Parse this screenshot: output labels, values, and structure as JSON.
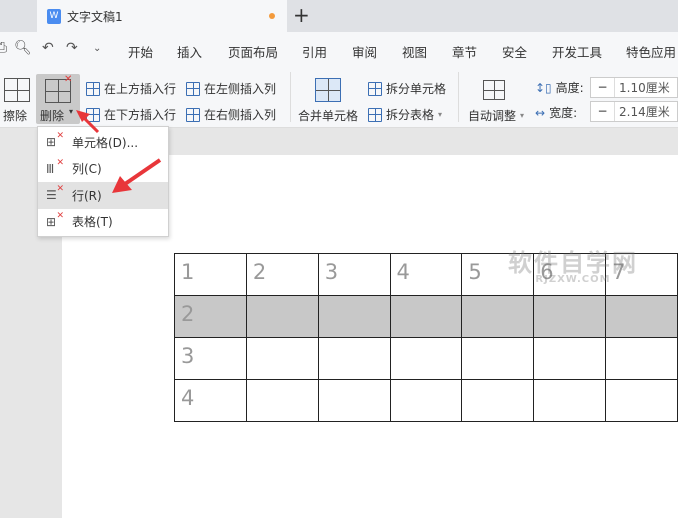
{
  "tab": {
    "title": "文字文稿1",
    "new_tab": "+"
  },
  "menu": [
    "开始",
    "插入",
    "页面布局",
    "引用",
    "审阅",
    "视图",
    "章节",
    "安全",
    "开发工具",
    "特色应用"
  ],
  "ribbon": {
    "erase": "擦除",
    "delete": "删除",
    "insert_above": "在上方插入行",
    "insert_below": "在下方插入行",
    "insert_left": "在左侧插入列",
    "insert_right": "在右侧插入列",
    "merge": "合并单元格",
    "split_cell": "拆分单元格",
    "split_table": "拆分表格",
    "auto_fit": "自动调整",
    "height_label": "高度:",
    "height_value": "1.10厘米",
    "width_label": "宽度:",
    "width_value": "2.14厘米",
    "minus": "−"
  },
  "dropdown": [
    {
      "label": "单元格(D)..."
    },
    {
      "label": "列(C)"
    },
    {
      "label": "行(R)"
    },
    {
      "label": "表格(T)"
    }
  ],
  "table": {
    "rows": [
      [
        "1",
        "2",
        "3",
        "4",
        "5",
        "6",
        "7"
      ],
      [
        "2",
        "",
        "",
        "",
        "",
        "",
        ""
      ],
      [
        "3",
        "",
        "",
        "",
        "",
        "",
        ""
      ],
      [
        "4",
        "",
        "",
        "",
        "",
        "",
        ""
      ]
    ]
  },
  "watermark": {
    "text": "软件自学网",
    "sub": "RJZXW.COM"
  },
  "colors": {
    "arrow": "#e8363a",
    "selection": "#c8c8c8"
  }
}
